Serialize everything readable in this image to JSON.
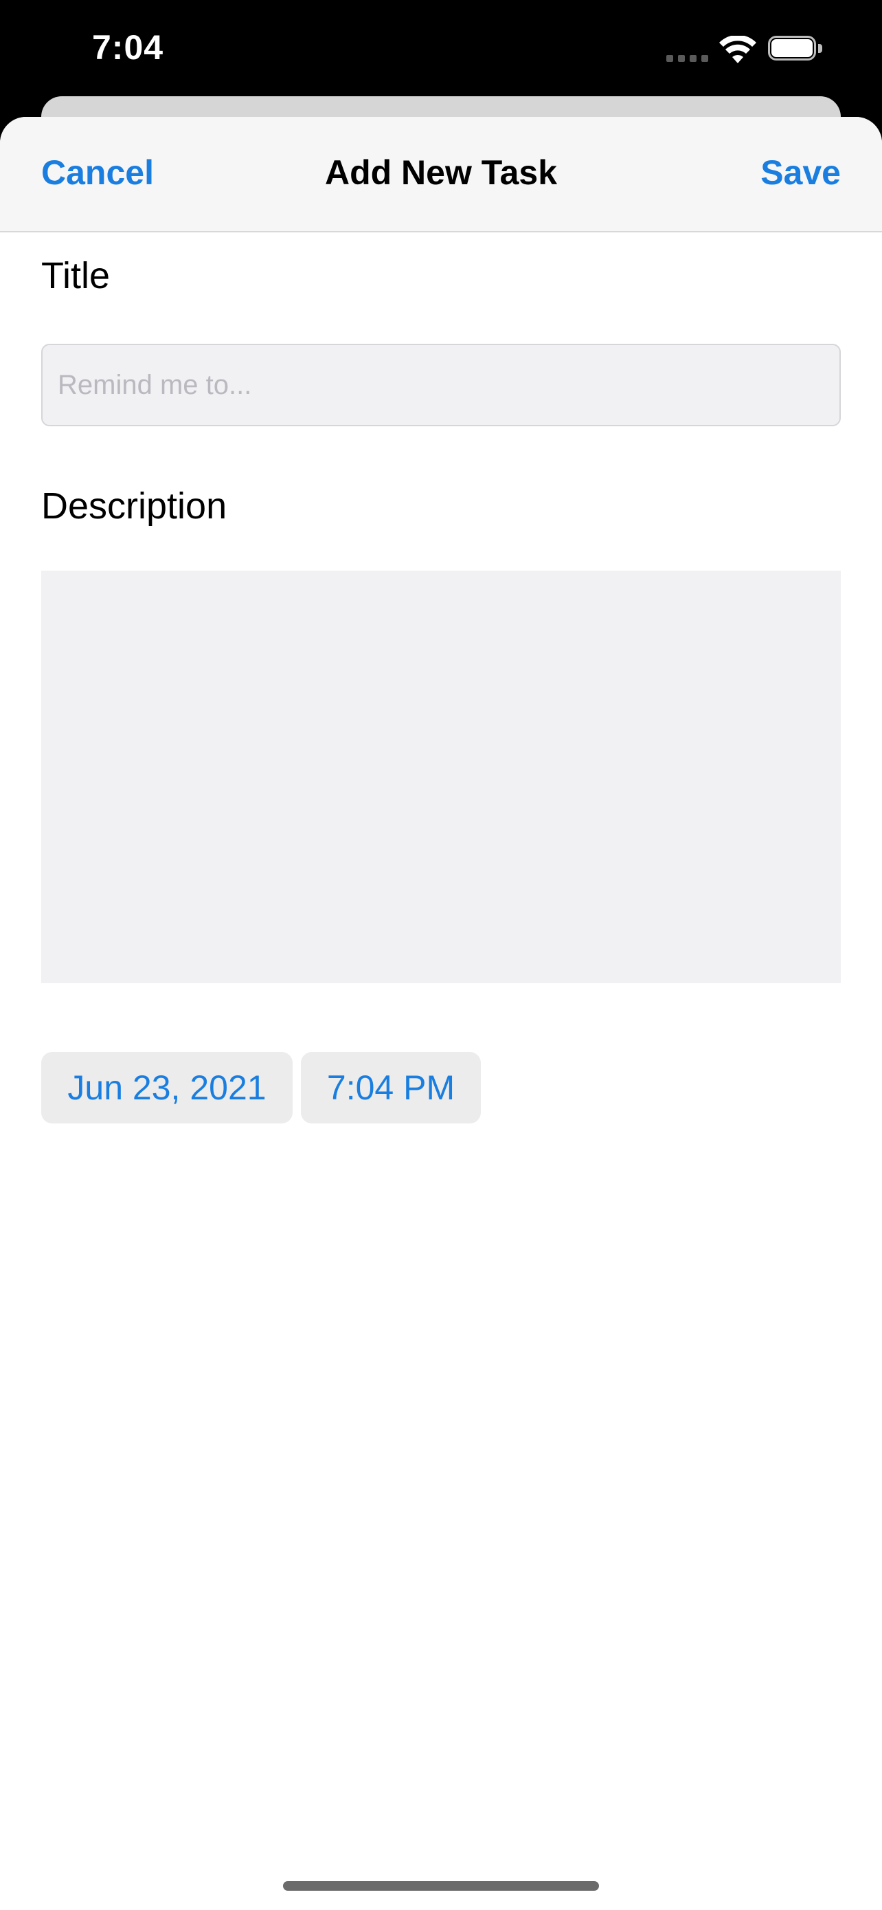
{
  "status_bar": {
    "time": "7:04",
    "icons": [
      "signal-icon",
      "wifi-icon",
      "battery-icon"
    ]
  },
  "nav": {
    "cancel_label": "Cancel",
    "title": "Add New Task",
    "save_label": "Save"
  },
  "form": {
    "title_label": "Title",
    "title_value": "",
    "title_placeholder": "Remind me to...",
    "description_label": "Description",
    "description_value": "",
    "date_value": "Jun 23, 2021",
    "time_value": "7:04 PM"
  },
  "colors": {
    "accent": "#1a7ee0",
    "field_background": "#f1f1f4",
    "nav_background": "#f6f6f6"
  }
}
